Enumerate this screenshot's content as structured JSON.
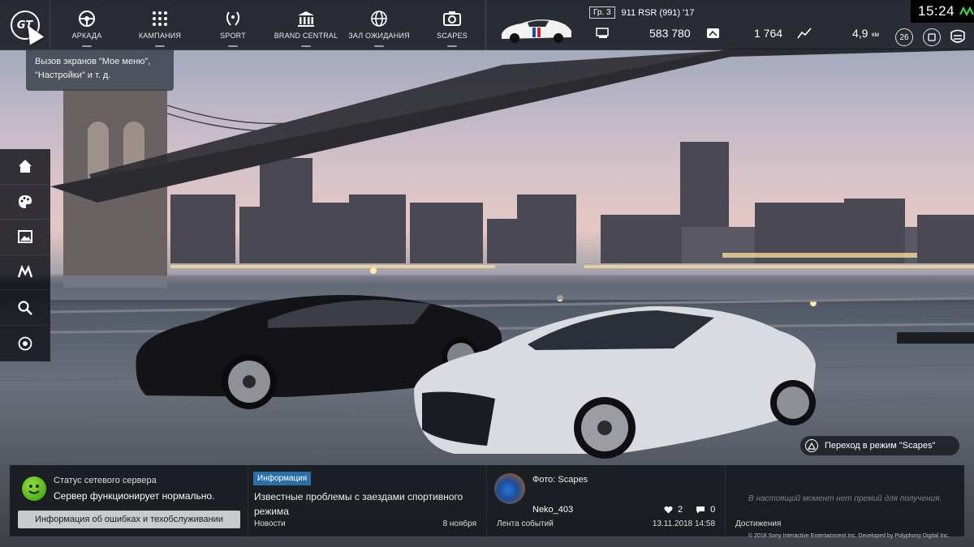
{
  "nav": {
    "items": [
      {
        "label": "АРКАДА",
        "icon": "steering-wheel-icon"
      },
      {
        "label": "КАМПАНИЯ",
        "icon": "dots-grid-icon"
      },
      {
        "label": "SPORT",
        "icon": "laurel-icon"
      },
      {
        "label": "BRAND CENTRAL",
        "icon": "building-icon"
      },
      {
        "label": "ЗАЛ ОЖИДАНИЯ",
        "icon": "globe-icon"
      },
      {
        "label": "SCAPES",
        "icon": "camera-icon"
      }
    ]
  },
  "car": {
    "group": "Гр. 3",
    "name": "911 RSR (991) '17"
  },
  "stats": {
    "credits": "583 780",
    "mileage": "1 764",
    "distance": "4,9",
    "distance_unit": "км",
    "level": "26"
  },
  "clock": {
    "time": "15:24"
  },
  "tooltip": {
    "line1": "Вызов экранов \"Мое меню\",",
    "line2": "\"Настройки\" и т. д."
  },
  "sidebar": {
    "items": [
      "home-icon",
      "palette-icon",
      "gallery-icon",
      "gt-auto-icon",
      "search-icon",
      "record-icon"
    ]
  },
  "scapes_hint": {
    "label": "Переход в режим \"Scapes\""
  },
  "server": {
    "title": "Статус сетевого сервера",
    "status": "Сервер функционирует нормально.",
    "button": "Информация об ошибках и техобслуживании"
  },
  "news": {
    "tag": "Информация",
    "body": "Известные проблемы с заездами спортивного режима",
    "footer_label": "Новости",
    "date": "8 ноября"
  },
  "feed": {
    "title": "Фото: Scapes",
    "user": "Neko_403",
    "likes": "2",
    "comments": "0",
    "footer_label": "Лента событий",
    "date": "13.11.2018 14:58"
  },
  "achievements": {
    "empty": "В настоящий момент нет премий для получения.",
    "footer_label": "Достижения"
  },
  "copyright": "© 2018 Sony Interactive Entertainment Inc. Developed by Polyphony Digital Inc.",
  "colors": {
    "accent_blue": "#2a6fa8",
    "status_green": "#5cc01e",
    "net_green": "#3be04a"
  }
}
